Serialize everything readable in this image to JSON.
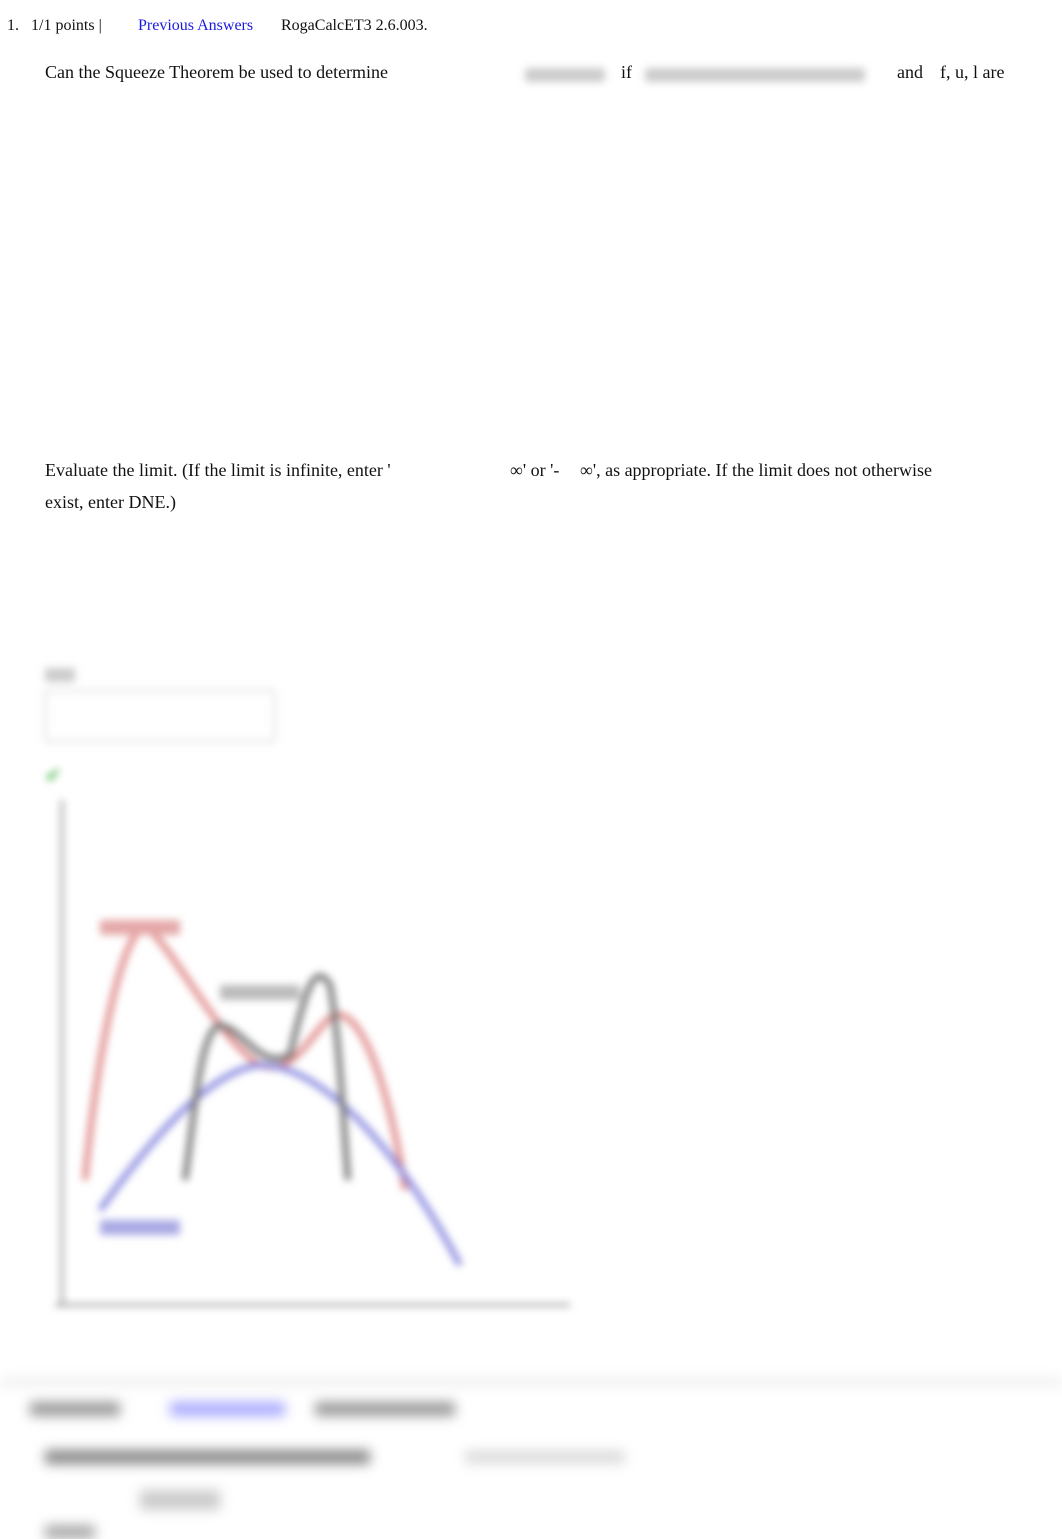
{
  "q1": {
    "number": "1.",
    "points": "1/1 points |",
    "previous_answers": "Previous Answers",
    "source": "RogaCalcET3 2.6.003.",
    "question_text": "Can the Squeeze Theorem be used to determine",
    "if_word": "if",
    "and_word": "and",
    "functions": "f,  u,  l are",
    "instruction_line1_a": "Evaluate the limit. (If the limit is infinite, enter '",
    "instruction_line1_b": "∞' or '-",
    "instruction_line1_c": "∞', as appropriate. If the limit does not otherwise",
    "instruction_line2": "exist, enter DNE.)"
  },
  "colors": {
    "link": "#1a1adf",
    "upper_curve": "#e08a8a",
    "lower_curve": "#8a8ae0",
    "middle_curve": "#555555",
    "check": "#33aa33"
  }
}
